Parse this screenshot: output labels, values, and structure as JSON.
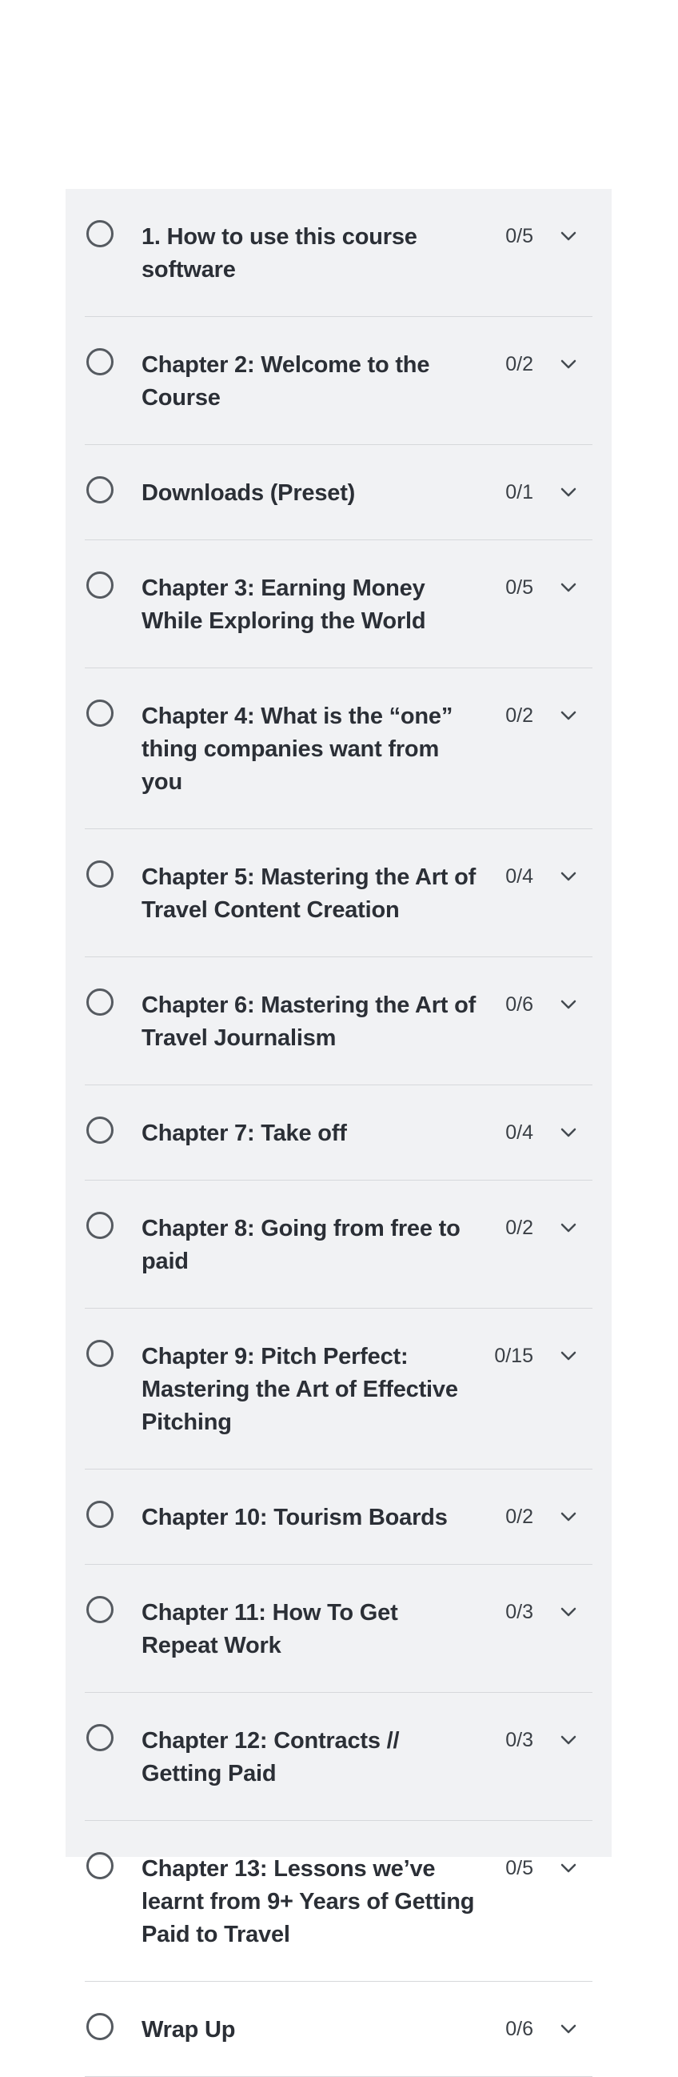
{
  "course": {
    "chapters": [
      {
        "title": "1. How to use this course software",
        "progress": "0/5"
      },
      {
        "title": "Chapter 2: Welcome to the Course",
        "progress": "0/2"
      },
      {
        "title": "Downloads (Preset)",
        "progress": "0/1"
      },
      {
        "title": "Chapter 3: Earning Money While Exploring the World",
        "progress": "0/5"
      },
      {
        "title": "Chapter 4: What is the “one” thing companies want from you",
        "progress": "0/2"
      },
      {
        "title": "Chapter 5: Mastering the Art of Travel Content Creation",
        "progress": "0/4"
      },
      {
        "title": "Chapter 6: Mastering the Art of Travel Journalism",
        "progress": "0/6"
      },
      {
        "title": "Chapter 7: Take off",
        "progress": "0/4"
      },
      {
        "title": "Chapter 8: Going from free to paid",
        "progress": "0/2"
      },
      {
        "title": "Chapter 9: Pitch Perfect: Mastering the Art of Effective Pitching",
        "progress": "0/15"
      },
      {
        "title": "Chapter 10: Tourism Boards",
        "progress": "0/2"
      },
      {
        "title": "Chapter 11: How To Get Repeat Work",
        "progress": "0/3"
      },
      {
        "title": "Chapter 12: Contracts // Getting Paid",
        "progress": "0/3"
      },
      {
        "title": "Chapter 13: Lessons we’ve learnt from 9+ Years of Getting Paid to Travel",
        "progress": "0/5"
      },
      {
        "title": "Wrap Up",
        "progress": "0/6"
      }
    ],
    "icons": {
      "status": "empty-circle-icon",
      "expand": "chevron-down-icon"
    },
    "colors": {
      "panel_background": "#f1f2f4",
      "text": "#2b2f36",
      "divider": "#d6d8db"
    }
  }
}
